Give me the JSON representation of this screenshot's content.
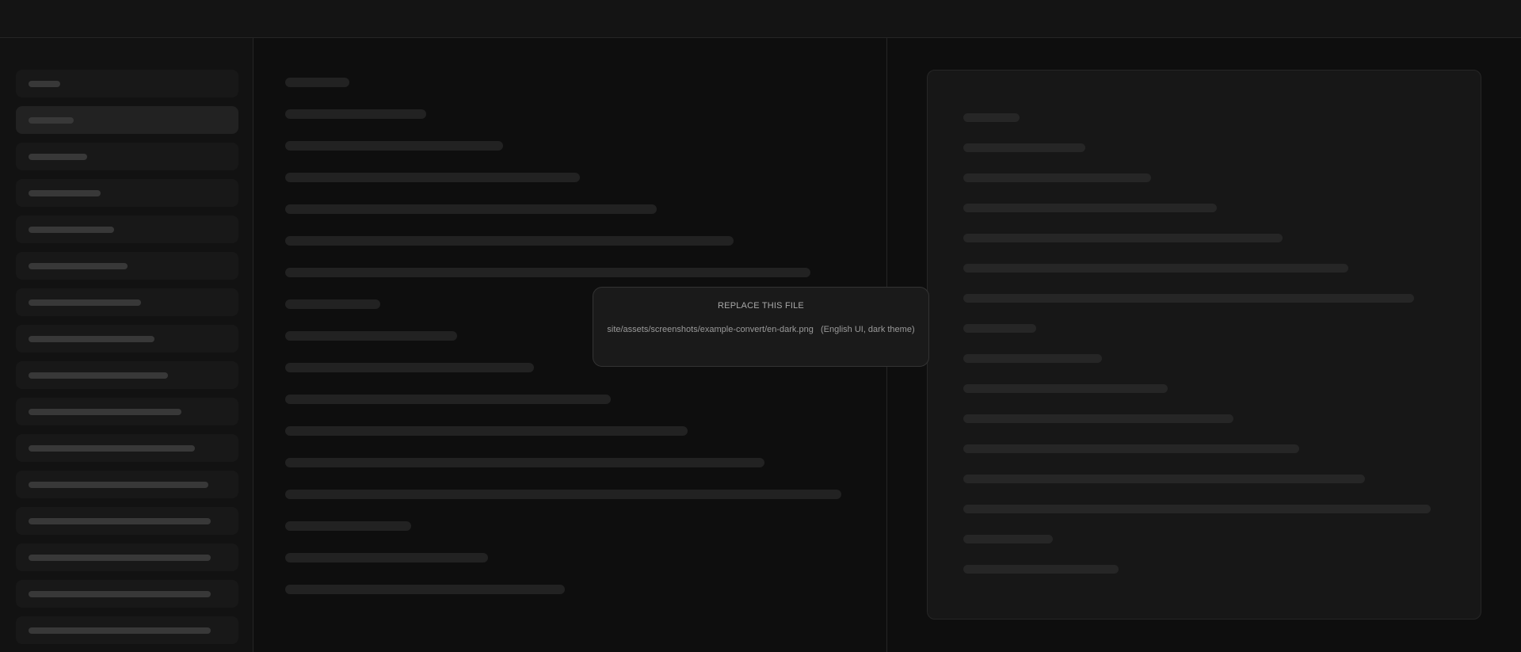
{
  "placeholder": {
    "title": "REPLACE THIS FILE",
    "path": "site/assets/screenshots/example-convert/en-dark.png",
    "note": "(English UI, dark theme)"
  },
  "sidebar": {
    "item_count": 16,
    "active_index": 1
  },
  "colors": {
    "background": "#0e0e0e",
    "panel": "#121212",
    "card": "#171717",
    "skeleton": "#222222",
    "text": "#a8a8a8"
  }
}
